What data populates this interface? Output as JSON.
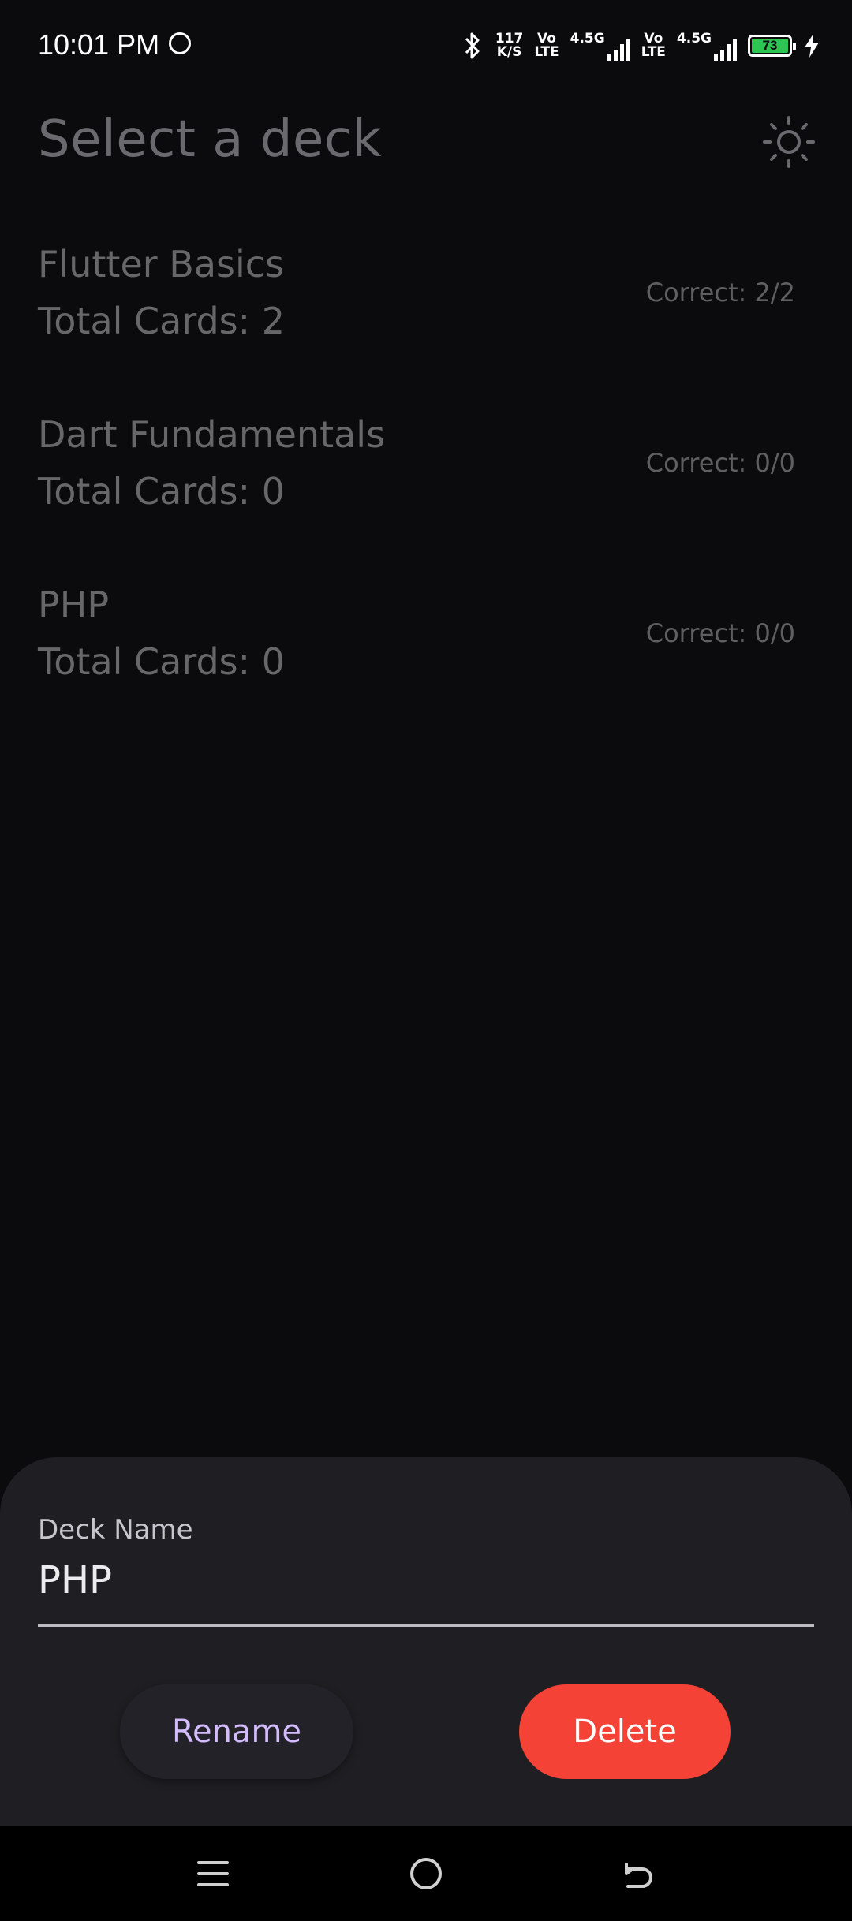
{
  "status_bar": {
    "time": "10:01 PM",
    "speed_value": "117",
    "speed_unit": "K/S",
    "sim1_top": "Vo",
    "sim1_bottom": "LTE",
    "sim1_network": "4.5G",
    "sim2_top": "Vo",
    "sim2_bottom": "LTE",
    "sim2_network": "4.5G",
    "battery_level": "73",
    "battery_color": "#2dc653"
  },
  "header": {
    "title": "Select a deck",
    "theme_icon": "sun-icon"
  },
  "decks": [
    {
      "name": "Flutter Basics",
      "total": "Total Cards: 2",
      "correct": "Correct: 2/2"
    },
    {
      "name": "Dart Fundamentals",
      "total": "Total Cards: 0",
      "correct": "Correct: 0/0"
    },
    {
      "name": "PHP",
      "total": "Total Cards: 0",
      "correct": "Correct: 0/0"
    }
  ],
  "sheet": {
    "field_label": "Deck Name",
    "field_value": "PHP",
    "rename_label": "Rename",
    "delete_label": "Delete",
    "rename_color": "#d3bcfd",
    "delete_color": "#f44336"
  },
  "nav": {
    "menu_icon": "menu-icon",
    "home_icon": "home-icon",
    "back_icon": "back-icon"
  }
}
